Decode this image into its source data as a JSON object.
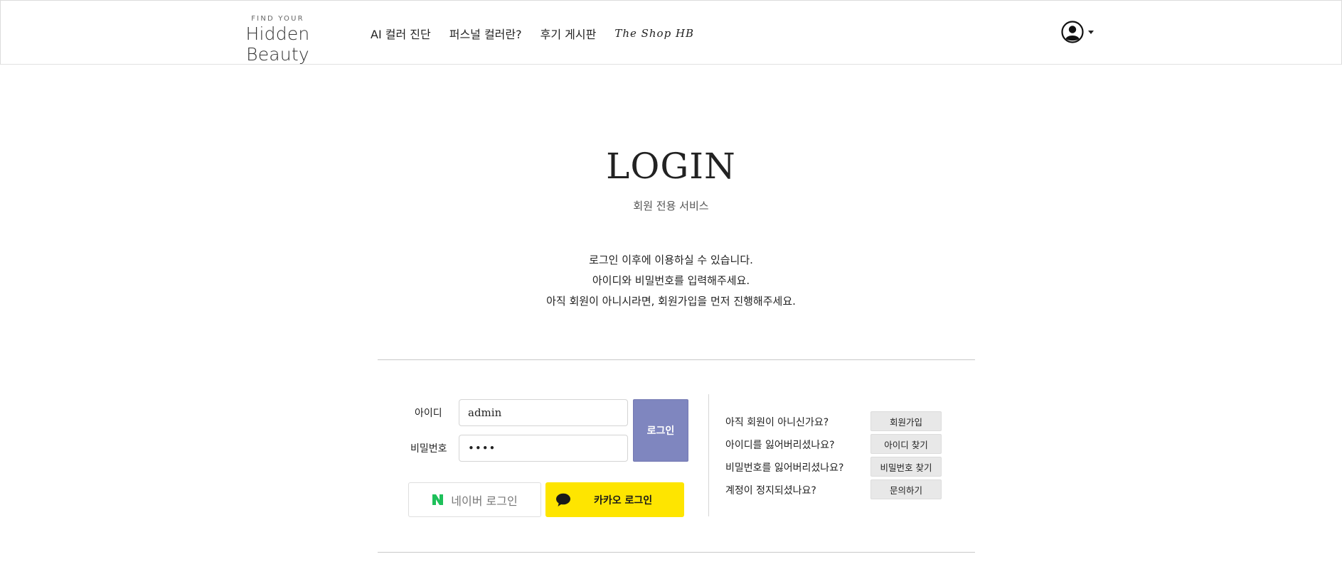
{
  "header": {
    "logo_small": "FIND YOUR",
    "logo_big": "Hidden Beauty",
    "nav": [
      "AI 컬러 진단",
      "퍼스널 컬러란?",
      "후기 게시판",
      "The Shop HB"
    ]
  },
  "main": {
    "title": "LOGIN",
    "subtitle": "회원 전용 서비스",
    "desc_lines": [
      "로그인 이후에 이용하실 수 있습니다.",
      "아이디와 비밀번호를 입력해주세요.",
      "아직 회원이 아니시라면, 회원가입을 먼저 진행해주세요."
    ]
  },
  "form": {
    "id_label": "아이디",
    "id_value": "admin",
    "pw_label": "비밀번호",
    "pw_value": "••••",
    "login_button": "로그인",
    "naver_button": "네이버 로그인",
    "kakao_button": "카카오 로그인"
  },
  "side": {
    "questions": [
      "아직 회원이 아니신가요?",
      "아이디를 잃어버리셨나요?",
      "비밀번호를 잃어버리셨나요?",
      "계정이 정지되셨나요?"
    ],
    "buttons": [
      "회원가입",
      "아이디 찾기",
      "비밀번호 찾기",
      "문의하기"
    ]
  },
  "colors": {
    "login_button": "#7f86bf",
    "kakao": "#fee500",
    "naver": "#1ec05a"
  }
}
